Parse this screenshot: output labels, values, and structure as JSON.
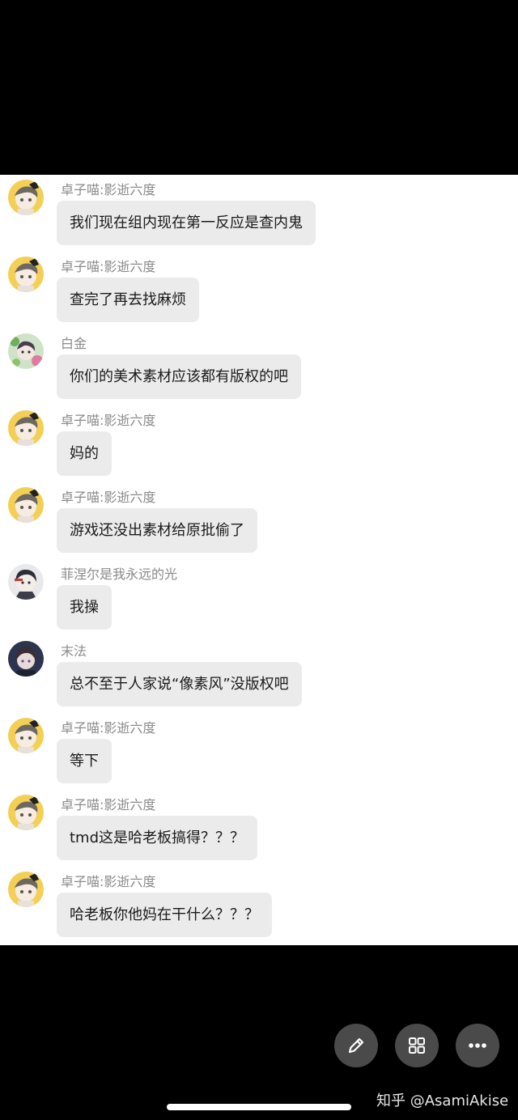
{
  "messages": [
    {
      "sender": "卓子喵:影逝六度",
      "text": "我们现在组内现在第一反应是查内鬼",
      "avatar": "yellow-haired-character"
    },
    {
      "sender": "卓子喵:影逝六度",
      "text": "查完了再去找麻烦",
      "avatar": "yellow-haired-character"
    },
    {
      "sender": "白金",
      "text": "你们的美术素材应该都有版权的吧",
      "avatar": "green-floral-character"
    },
    {
      "sender": "卓子喵:影逝六度",
      "text": "妈的",
      "avatar": "yellow-haired-character"
    },
    {
      "sender": "卓子喵:影逝六度",
      "text": "游戏还没出素材给原批偷了",
      "avatar": "yellow-haired-character"
    },
    {
      "sender": "菲涅尔是我永远的光",
      "text": "我操",
      "avatar": "dark-haired-character"
    },
    {
      "sender": "末法",
      "text": "总不至于人家说“像素风”没版权吧",
      "avatar": "dark-blue-character"
    },
    {
      "sender": "卓子喵:影逝六度",
      "text": "等下",
      "avatar": "yellow-haired-character"
    },
    {
      "sender": "卓子喵:影逝六度",
      "text": "tmd这是哈老板搞得？？？",
      "avatar": "yellow-haired-character"
    },
    {
      "sender": "卓子喵:影逝六度",
      "text": "哈老板你他妈在干什么？？？",
      "avatar": "yellow-haired-character"
    }
  ],
  "actions": [
    {
      "icon": "pencil-icon"
    },
    {
      "icon": "grid-icon"
    },
    {
      "icon": "more-icon"
    }
  ],
  "watermark": "知乎 @AsamiAkise"
}
